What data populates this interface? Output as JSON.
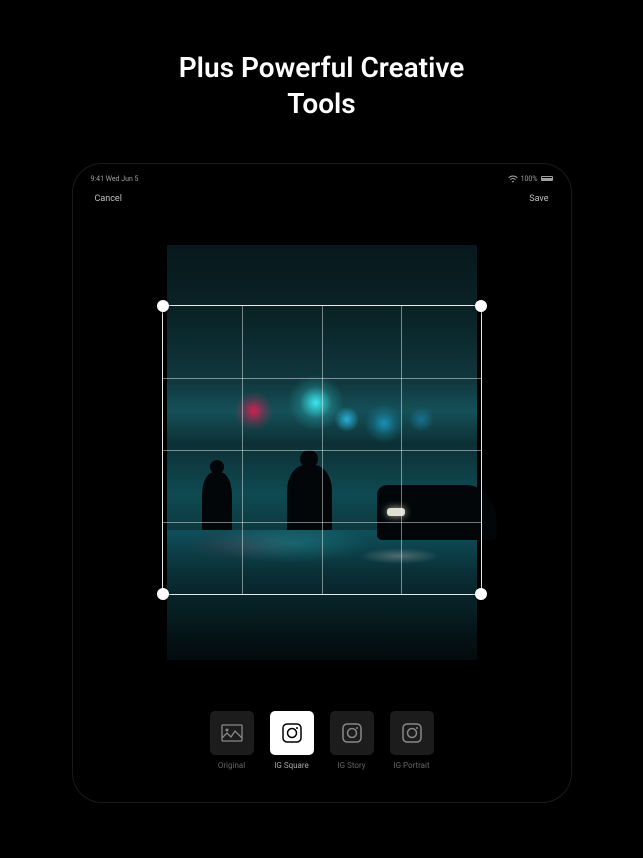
{
  "promo": {
    "line1": "Plus Powerful Creative",
    "line2": "Tools"
  },
  "statusbar": {
    "time": "9:41 Wed Jun 5",
    "wifi": "wifi-icon",
    "battery": "100%"
  },
  "topbar": {
    "cancel": "Cancel",
    "save": "Save"
  },
  "crop_options": [
    {
      "id": "original",
      "label": "Original",
      "icon": "image-icon",
      "active": false
    },
    {
      "id": "igsquare",
      "label": "IG Square",
      "icon": "square-icon",
      "active": true
    },
    {
      "id": "igstory",
      "label": "IG Story",
      "icon": "story-icon",
      "active": false
    },
    {
      "id": "igportrait",
      "label": "IG Portrait",
      "icon": "portrait-icon",
      "active": false
    }
  ]
}
